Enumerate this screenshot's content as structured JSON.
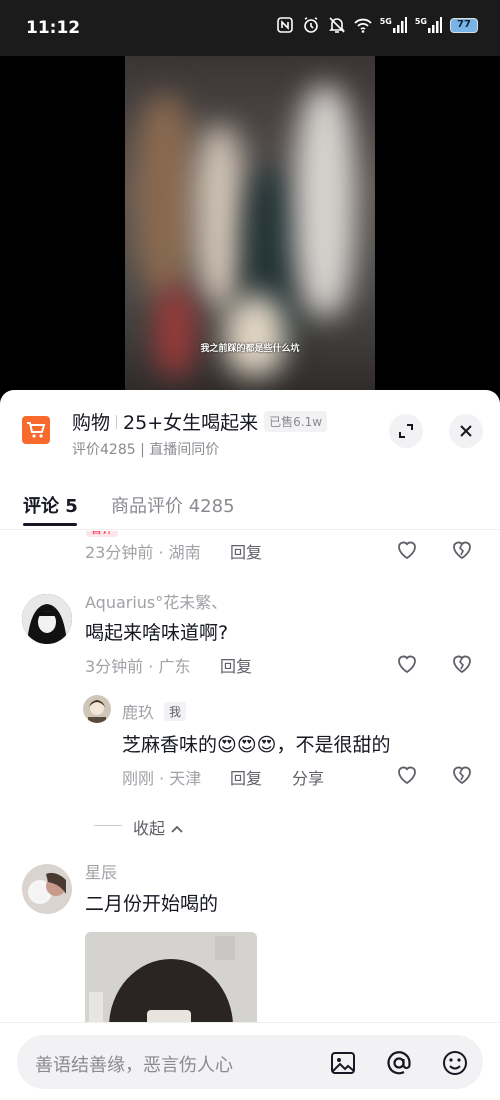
{
  "status_bar": {
    "time": "11:12",
    "signal1": "5G",
    "signal2": "5G",
    "battery": "77",
    "icons": [
      "nfc-icon",
      "alarm-icon",
      "mute-bell-icon",
      "wifi-icon",
      "signal-icon",
      "signal-icon",
      "battery-icon"
    ]
  },
  "video": {
    "subtitle": "我之前踩的都是些什么坑"
  },
  "shop": {
    "category": "购物",
    "title": "25+女生喝起来",
    "sold": "已售6.1w",
    "subinfo": "评价4285 | 直播间同价",
    "icon": "shopping-cart-icon",
    "accent": "#f7692d"
  },
  "tabs": [
    {
      "label": "评论 5"
    },
    {
      "label": "商品评价 4285"
    }
  ],
  "comments": {
    "partial": {
      "tag": "首评",
      "time": "23分钟前 · 湖南",
      "reply": "回复"
    },
    "c1": {
      "user": "Aquarius°花未繁、",
      "text": "喝起来啥味道啊?",
      "time": "3分钟前 · 广东",
      "reply": "回复"
    },
    "c1_reply": {
      "user": "鹿玖",
      "badge": "我",
      "text_before": "芝麻香味的",
      "emoji": "😍😍😍",
      "text_after": "，不是很甜的",
      "time": "刚刚 · 天津",
      "reply": "回复",
      "share": "分享"
    },
    "collapse": "收起",
    "c2": {
      "user": "星辰",
      "text": "二月份开始喝的"
    }
  },
  "input": {
    "placeholder": "善语结善缘，恶言伤人心"
  },
  "colors": {
    "text_primary": "#161823",
    "text_secondary": "#8a8b91",
    "like_red": "#fe2c55"
  }
}
